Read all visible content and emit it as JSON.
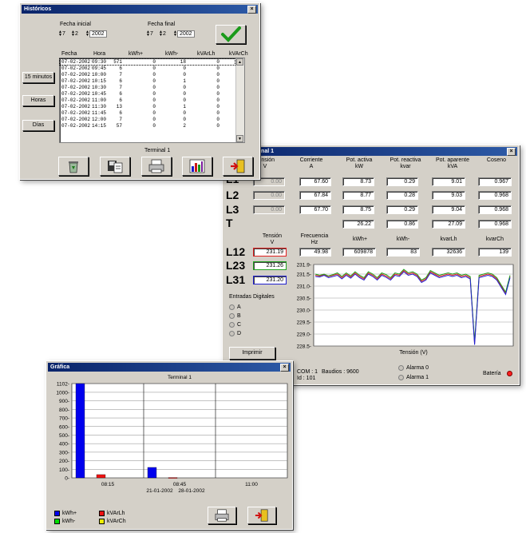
{
  "historicos": {
    "title": "Históricos",
    "fecha_inicial_label": "Fecha inicial",
    "fecha_final_label": "Fecha final",
    "fecha_inicial": {
      "dia": "7",
      "mes": "2",
      "anio": "2002"
    },
    "fecha_final": {
      "dia": "7",
      "mes": "2",
      "anio": "2002"
    },
    "columns": [
      "Fecha",
      "Hora",
      "kWh+",
      "kWh-",
      "kVArLh",
      "kVArCh"
    ],
    "rows": [
      [
        "07-02-2002",
        "09:30",
        "571",
        "0",
        "18",
        "0"
      ],
      [
        "07-02-2002",
        "09:45",
        "6",
        "0",
        "0",
        "0"
      ],
      [
        "07-02-2002",
        "10:00",
        "7",
        "0",
        "0",
        "0"
      ],
      [
        "07-02-2002",
        "10:15",
        "6",
        "0",
        "1",
        "0"
      ],
      [
        "07-02-2002",
        "10:30",
        "7",
        "0",
        "0",
        "0"
      ],
      [
        "07-02-2002",
        "10:45",
        "6",
        "0",
        "0",
        "0"
      ],
      [
        "07-02-2002",
        "11:00",
        "6",
        "0",
        "0",
        "0"
      ],
      [
        "07-02-2002",
        "11:30",
        "13",
        "0",
        "1",
        "0"
      ],
      [
        "07-02-2002",
        "11:45",
        "6",
        "0",
        "0",
        "0"
      ],
      [
        "07-02-2002",
        "12:00",
        "7",
        "0",
        "0",
        "0"
      ],
      [
        "07-02-2002",
        "14:15",
        "57",
        "0",
        "2",
        "0"
      ]
    ],
    "side_buttons": [
      "15 minutos",
      "Horas",
      "Días"
    ],
    "footer_label": "Terminal 1",
    "icons": [
      "recycle-bin-icon",
      "export-disk-icon",
      "printer-icon",
      "bar-chart-icon",
      "exit-door-icon"
    ],
    "accept_icon": "checkmark-icon"
  },
  "terminal": {
    "title": "...itos - Terminal 1",
    "col_headers": [
      {
        "name": "Tensión",
        "unit": "V"
      },
      {
        "name": "Corriente",
        "unit": "A"
      },
      {
        "name": "Pot. activa",
        "unit": "kW"
      },
      {
        "name": "Pot. reactiva",
        "unit": "kvar"
      },
      {
        "name": "Pot. aparente",
        "unit": "kVA"
      },
      {
        "name": "Coseno",
        "unit": ""
      }
    ],
    "phases": [
      {
        "label": "L1",
        "tension": "0.00",
        "corriente": "67.60",
        "p_activa": "8.73",
        "p_reactiva": "0.29",
        "p_aparente": "9.01",
        "coseno": "0.967"
      },
      {
        "label": "L2",
        "tension": "0.00",
        "corriente": "67.84",
        "p_activa": "8.77",
        "p_reactiva": "0.28",
        "p_aparente": "9.03",
        "coseno": "0.968"
      },
      {
        "label": "L3",
        "tension": "0.00",
        "corriente": "67.70",
        "p_activa": "8.75",
        "p_reactiva": "0.29",
        "p_aparente": "9.04",
        "coseno": "0.968"
      }
    ],
    "total": {
      "label": "T",
      "p_activa": "26.22",
      "p_reactiva": "0.86",
      "p_aparente": "27.09",
      "coseno": "0.968"
    },
    "line_headers": [
      {
        "name": "Tensión",
        "unit": "V"
      },
      {
        "name": "Frecuencia",
        "unit": "Hz"
      },
      {
        "name": "kWh+",
        "unit": ""
      },
      {
        "name": "kWh-",
        "unit": ""
      },
      {
        "name": "kvarLh",
        "unit": ""
      },
      {
        "name": "kvarCh",
        "unit": ""
      }
    ],
    "lines": [
      {
        "label": "L12",
        "tension": "231.19",
        "color": "#e02020"
      },
      {
        "label": "L23",
        "tension": "231.26",
        "color": "#20a020"
      },
      {
        "label": "L31",
        "tension": "231.20",
        "color": "#2020d0"
      }
    ],
    "frecuencia": "49.98",
    "kwh_pos": "609878",
    "kwh_neg": "83",
    "kvarlh": "32636",
    "kvarch": "139",
    "entradas_label": "Entradas Digitales",
    "entradas": [
      "A",
      "B",
      "C",
      "D"
    ],
    "imprimir": "Imprimir",
    "com": "COM : 1",
    "baudios": "Baudios : 9600",
    "id": "Id : 101",
    "alarmas": [
      "Alarma 0",
      "Alarma 1"
    ],
    "bateria": "Batería",
    "bateria_color": "#ff2020"
  },
  "grafica": {
    "title": "Gráfica",
    "chart_title": "Terminal 1",
    "legend": [
      {
        "label": "kWh+",
        "color": "#0000ee"
      },
      {
        "label": "kWh-",
        "color": "#00dd00"
      },
      {
        "label": "kVArLh",
        "color": "#ee1111"
      },
      {
        "label": "kVArCh",
        "color": "#eeee00"
      }
    ],
    "icons": [
      "printer-icon",
      "exit-door-icon"
    ]
  },
  "chart_data": [
    {
      "type": "line",
      "title": "",
      "xlabel": "Tensión (V)",
      "ylabel": "",
      "ylim": [
        228.5,
        231.9
      ],
      "yticks": [
        "231.9",
        "231.5",
        "231.0",
        "230.5",
        "230.0",
        "229.5",
        "229.0",
        "228.5"
      ],
      "grid": true,
      "series": [
        {
          "name": "L12",
          "color": "#e02020",
          "values": [
            231.45,
            231.42,
            231.48,
            231.4,
            231.45,
            231.5,
            231.35,
            231.5,
            231.38,
            231.55,
            231.4,
            231.3,
            231.55,
            231.45,
            231.3,
            231.5,
            231.42,
            231.3,
            231.5,
            231.45,
            231.65,
            231.5,
            231.55,
            231.45,
            231.2,
            231.3,
            231.6,
            231.5,
            231.4,
            231.45,
            231.5,
            231.45,
            231.5,
            231.4,
            231.45,
            231.35,
            228.6,
            231.4,
            231.45,
            231.5,
            231.45,
            231.3,
            231.0,
            230.7,
            231.4
          ]
        },
        {
          "name": "L23",
          "color": "#20a020",
          "values": [
            231.5,
            231.45,
            231.5,
            231.42,
            231.48,
            231.55,
            231.4,
            231.55,
            231.42,
            231.6,
            231.45,
            231.35,
            231.6,
            231.5,
            231.35,
            231.55,
            231.48,
            231.35,
            231.55,
            231.5,
            231.7,
            231.55,
            231.6,
            231.5,
            231.25,
            231.35,
            231.65,
            231.55,
            231.45,
            231.5,
            231.55,
            231.5,
            231.55,
            231.45,
            231.5,
            231.4,
            228.7,
            231.45,
            231.5,
            231.55,
            231.5,
            231.35,
            231.05,
            230.75,
            231.45
          ]
        },
        {
          "name": "L31",
          "color": "#2020d0",
          "values": [
            231.4,
            231.38,
            231.45,
            231.35,
            231.4,
            231.45,
            231.3,
            231.45,
            231.33,
            231.5,
            231.35,
            231.25,
            231.5,
            231.4,
            231.25,
            231.45,
            231.37,
            231.25,
            231.45,
            231.4,
            231.6,
            231.45,
            231.5,
            231.4,
            231.15,
            231.25,
            231.55,
            231.45,
            231.35,
            231.4,
            231.45,
            231.4,
            231.45,
            231.35,
            231.4,
            231.3,
            228.55,
            231.35,
            231.4,
            231.45,
            231.4,
            231.25,
            230.95,
            230.65,
            231.35
          ]
        }
      ]
    },
    {
      "type": "bar",
      "title": "Terminal 1",
      "categories": [
        "08:15",
        "08:45",
        "11:00"
      ],
      "extra_xlabels": [
        "21-01-2002",
        "28-01-2002"
      ],
      "ylim": [
        0,
        1102
      ],
      "yticks": [
        "1102",
        "1000",
        "900",
        "800",
        "700",
        "600",
        "500",
        "400",
        "300",
        "200",
        "100",
        "0"
      ],
      "grid": true,
      "series": [
        {
          "name": "kWh+",
          "color": "#0000ee",
          "values": [
            1102,
            122,
            0
          ]
        },
        {
          "name": "kWh-",
          "color": "#00dd00",
          "values": [
            0,
            0,
            0
          ]
        },
        {
          "name": "kVArLh",
          "color": "#ee1111",
          "values": [
            38,
            4,
            0
          ]
        },
        {
          "name": "kVArCh",
          "color": "#eeee00",
          "values": [
            0,
            0,
            0
          ]
        }
      ]
    }
  ]
}
